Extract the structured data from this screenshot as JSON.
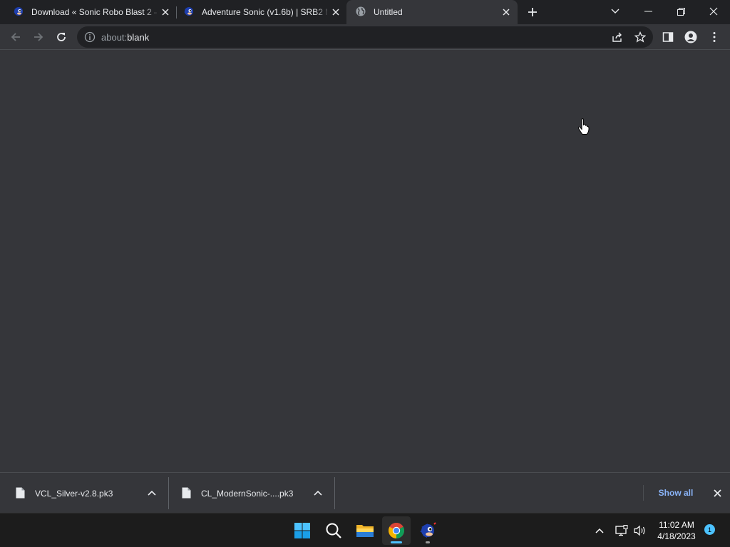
{
  "tabs": [
    {
      "title": "Download « Sonic Robo Blast 2 –",
      "favicon": "sonic-favicon-icon",
      "active": false
    },
    {
      "title": "Adventure Sonic (v1.6b) | SRB2 M",
      "favicon": "sonic-favicon-icon",
      "active": false
    },
    {
      "title": "Untitled",
      "favicon": "globe-icon",
      "active": true
    }
  ],
  "omnibox": {
    "url_scheme": "about:",
    "url_rest": "blank"
  },
  "downloads": [
    {
      "name": "VCL_Silver-v2.8.pk3"
    },
    {
      "name": "CL_ModernSonic-....pk3"
    }
  ],
  "shelf": {
    "show_all_label": "Show all"
  },
  "taskbar": {
    "time": "11:02 AM",
    "date": "4/18/2023",
    "notification_count": "1"
  },
  "colors": {
    "tabstrip": "#202124",
    "toolbar": "#35363a",
    "accent_link": "#8ab4f8",
    "taskbar": "#1c1c1c"
  }
}
